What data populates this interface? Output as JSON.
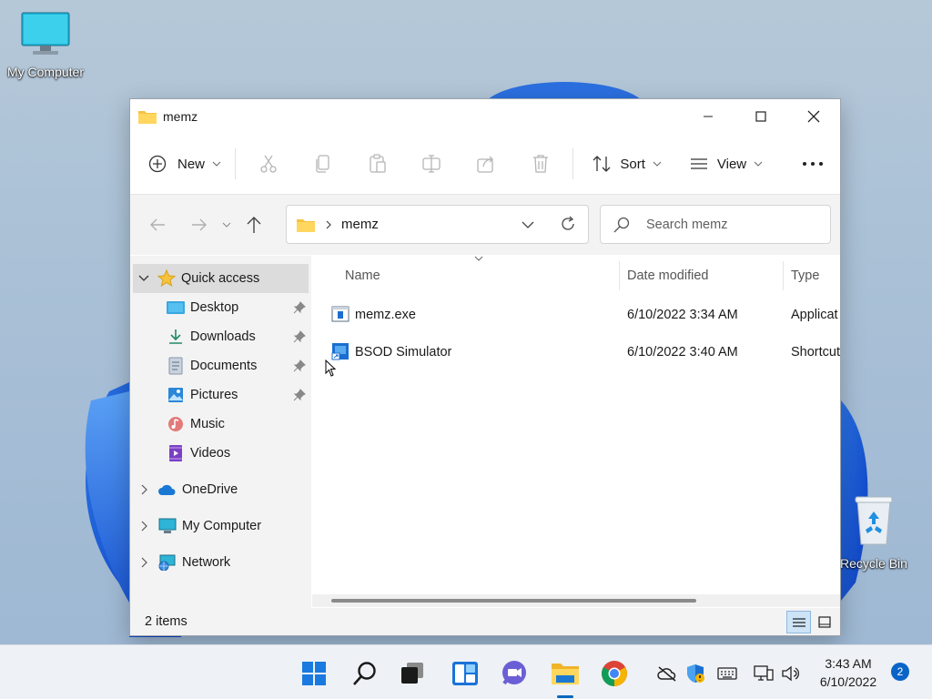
{
  "desktop": {
    "icons": [
      {
        "label": "My Computer",
        "icon": "monitor-icon"
      },
      {
        "label": "Recycle Bin",
        "icon": "recycle-bin-icon"
      }
    ]
  },
  "window": {
    "title": "memz",
    "toolbar": {
      "new_label": "New",
      "sort_label": "Sort",
      "view_label": "View",
      "icons": [
        "cut-icon",
        "copy-icon",
        "paste-icon",
        "rename-icon",
        "share-icon",
        "delete-icon"
      ]
    },
    "address": {
      "segment": "memz"
    },
    "search": {
      "placeholder": "Search memz"
    },
    "sidebar": {
      "quick_access": "Quick access",
      "items": [
        {
          "label": "Desktop",
          "icon": "desktop-folder-icon",
          "pinned": true
        },
        {
          "label": "Downloads",
          "icon": "download-arrow-icon",
          "pinned": true
        },
        {
          "label": "Documents",
          "icon": "documents-icon",
          "pinned": true
        },
        {
          "label": "Pictures",
          "icon": "pictures-icon",
          "pinned": true
        },
        {
          "label": "Music",
          "icon": "music-icon",
          "pinned": false
        },
        {
          "label": "Videos",
          "icon": "videos-icon",
          "pinned": false
        }
      ],
      "roots": [
        {
          "label": "OneDrive",
          "icon": "cloud-icon"
        },
        {
          "label": "My Computer",
          "icon": "monitor-icon"
        },
        {
          "label": "Network",
          "icon": "network-icon"
        }
      ]
    },
    "columns": {
      "name": "Name",
      "date": "Date modified",
      "type": "Type"
    },
    "files": [
      {
        "name": "memz.exe",
        "date": "6/10/2022 3:34 AM",
        "type": "Applicat",
        "icon": "application-icon"
      },
      {
        "name": "BSOD Simulator",
        "date": "6/10/2022 3:40 AM",
        "type": "Shortcut",
        "icon": "shortcut-icon"
      }
    ],
    "status": {
      "count": "2 items"
    }
  },
  "taskbar": {
    "apps": [
      "start-icon",
      "search-icon",
      "task-view-icon",
      "widgets-icon",
      "teams-chat-icon",
      "file-explorer-icon",
      "chrome-icon"
    ],
    "tray": [
      "cloud-offline-icon",
      "defender-icon",
      "keyboard-icon",
      "network-icon",
      "volume-icon"
    ],
    "time": "3:43 AM",
    "date": "6/10/2022",
    "notifications": "2"
  },
  "colors": {
    "accent": "#0067c0",
    "folder": "#f5c342",
    "taskbar": "#eef1f5"
  }
}
